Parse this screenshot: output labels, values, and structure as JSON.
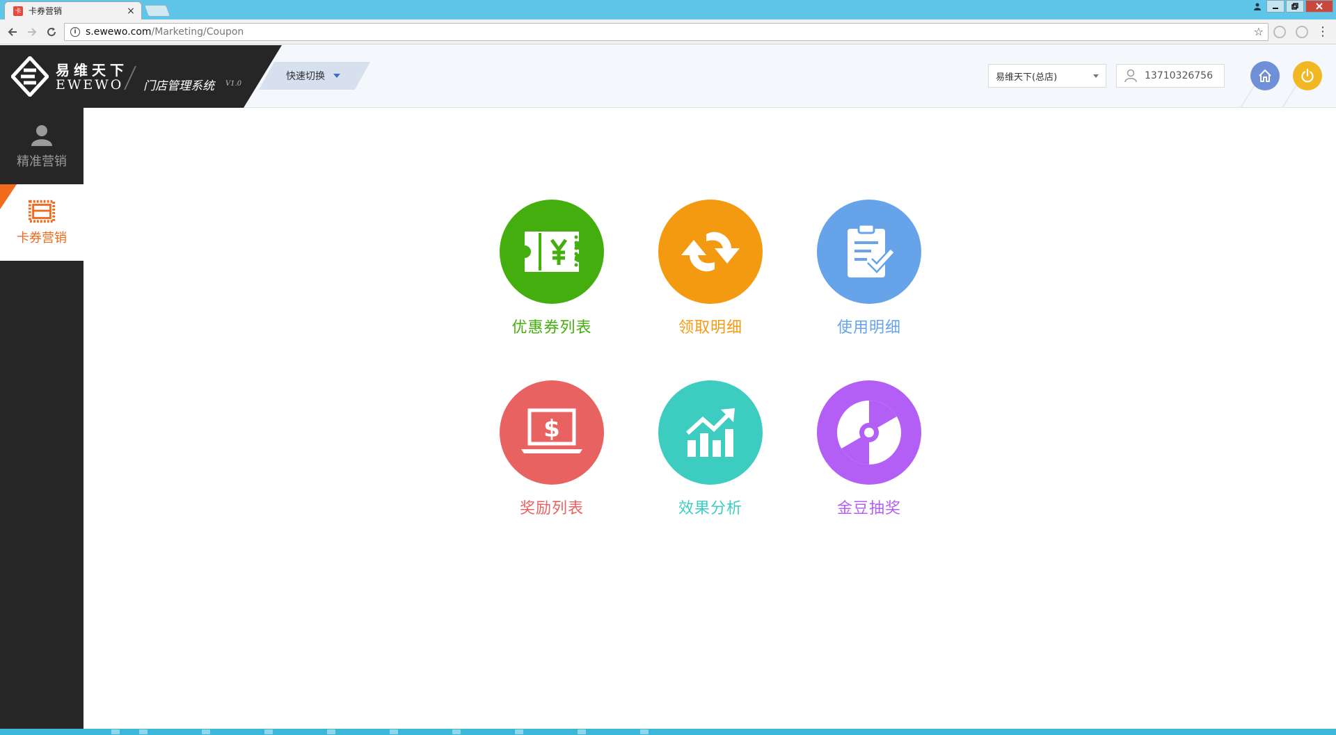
{
  "browser": {
    "tab_title": "卡券营销",
    "tab_close": "×",
    "url_host": "s.ewewo.com",
    "url_path": "/Marketing/Coupon",
    "window_buttons": [
      "minimize",
      "restore",
      "close"
    ]
  },
  "header": {
    "logo_cn": "易维天下",
    "logo_en": "EWEWO",
    "system_name": "门店管理系统",
    "system_version": "V1.0",
    "quick_switch_label": "快速切换",
    "store_select_value": "易维天下(总店)",
    "username": "13710326756"
  },
  "sidebar": {
    "items": [
      {
        "label": "精准营销",
        "icon": "user-icon",
        "active": false
      },
      {
        "label": "卡券营销",
        "icon": "ticket-icon",
        "active": true
      }
    ]
  },
  "main": {
    "tiles": [
      {
        "label": "优惠券列表",
        "icon": "coupon-icon",
        "color": "#45ae0f"
      },
      {
        "label": "领取明细",
        "icon": "refresh-arrows-icon",
        "color": "#f39a10"
      },
      {
        "label": "使用明细",
        "icon": "clipboard-check-icon",
        "color": "#66a3e8"
      },
      {
        "label": "奖励列表",
        "icon": "laptop-dollar-icon",
        "color": "#e96262"
      },
      {
        "label": "效果分析",
        "icon": "chart-growth-icon",
        "color": "#3ccdc0"
      },
      {
        "label": "金豆抽奖",
        "icon": "lottery-wheel-icon",
        "color": "#b35ff5"
      }
    ]
  },
  "colors": {
    "accent_orange": "#f26b1d",
    "sidebar_bg": "#262626",
    "header_bg": "#f4f7fb"
  }
}
